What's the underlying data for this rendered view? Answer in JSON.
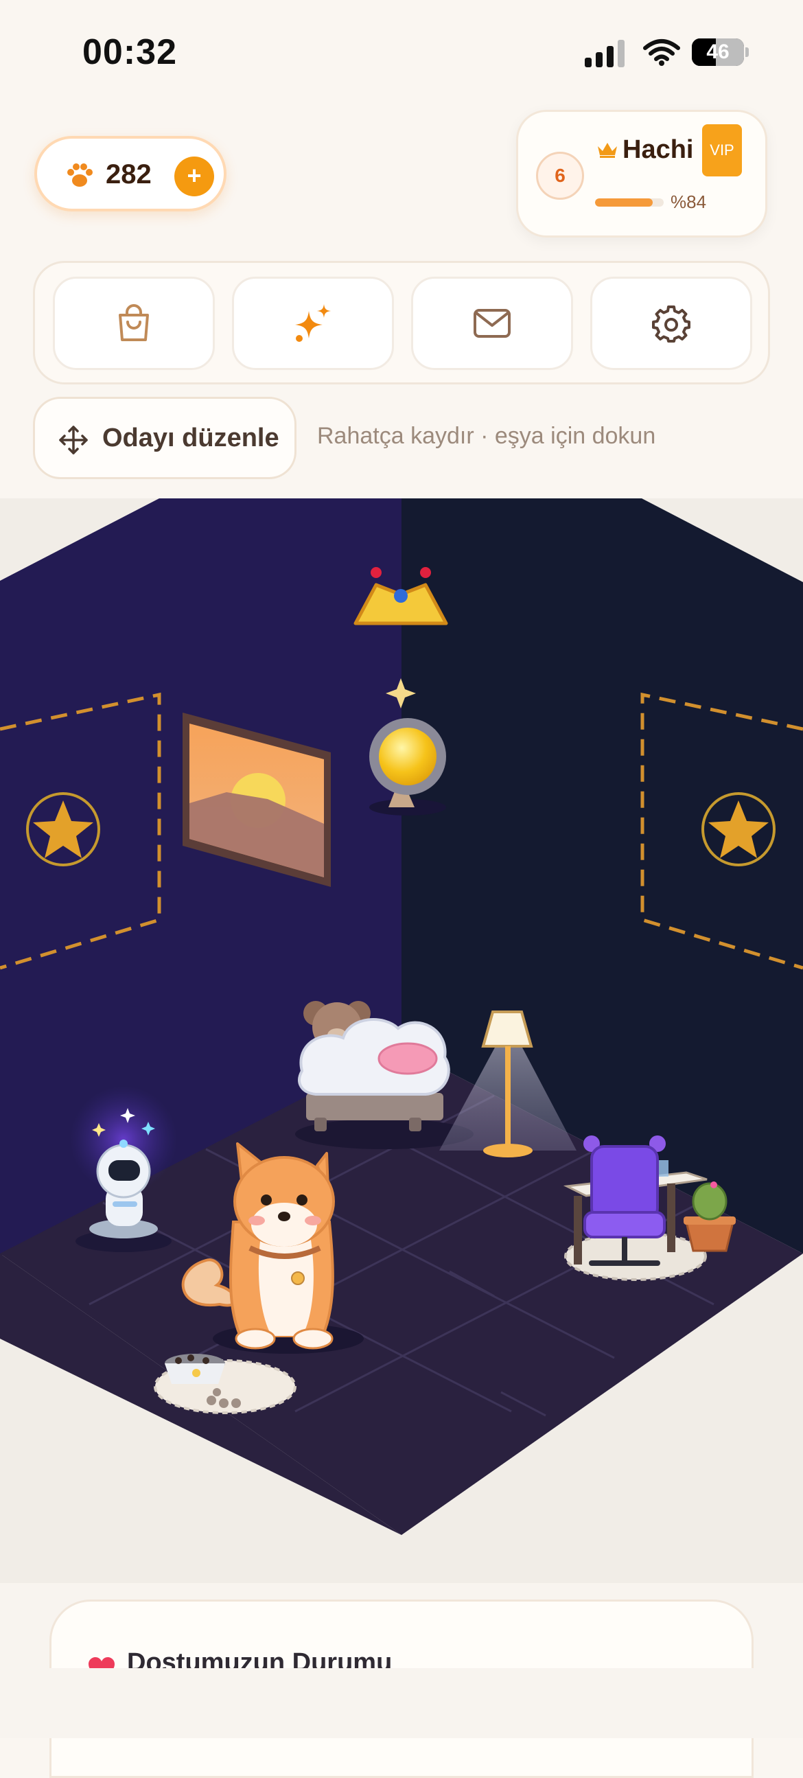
{
  "status_bar": {
    "time": "00:32",
    "battery": "46",
    "battery_level": 0.46
  },
  "header": {
    "coins": {
      "value": "282",
      "add_label": "+",
      "icon": "paw-icon"
    },
    "profile": {
      "level": "6",
      "name": "Hachi",
      "badge": "VIP",
      "xp_text": "%84",
      "xp_progress": 0.84,
      "icon": "crown-icon"
    }
  },
  "toolbar": {
    "items": [
      {
        "name": "shop",
        "icon": "shopping-bag-icon"
      },
      {
        "name": "effects",
        "icon": "sparkles-icon"
      },
      {
        "name": "inbox",
        "icon": "mail-icon"
      },
      {
        "name": "settings",
        "icon": "gear-icon"
      }
    ]
  },
  "edit": {
    "button_label": "Odayı düzenle",
    "hint": "Rahatça kaydır · eşya için dokun"
  },
  "room": {
    "objects": [
      "crown",
      "sun-lamp",
      "sunset-painting",
      "star-frame-left",
      "star-frame-right",
      "bed-with-teddy",
      "floor-lamp",
      "robot",
      "shiba-dog",
      "food-bowl",
      "desk-chair",
      "cactus"
    ]
  },
  "colors": {
    "accent": "#f59a10",
    "wall_left": "#231b53",
    "wall_right": "#141a30",
    "floor": "#2a213f"
  },
  "status_card": {
    "title": "Dostumuzun Durumu"
  }
}
